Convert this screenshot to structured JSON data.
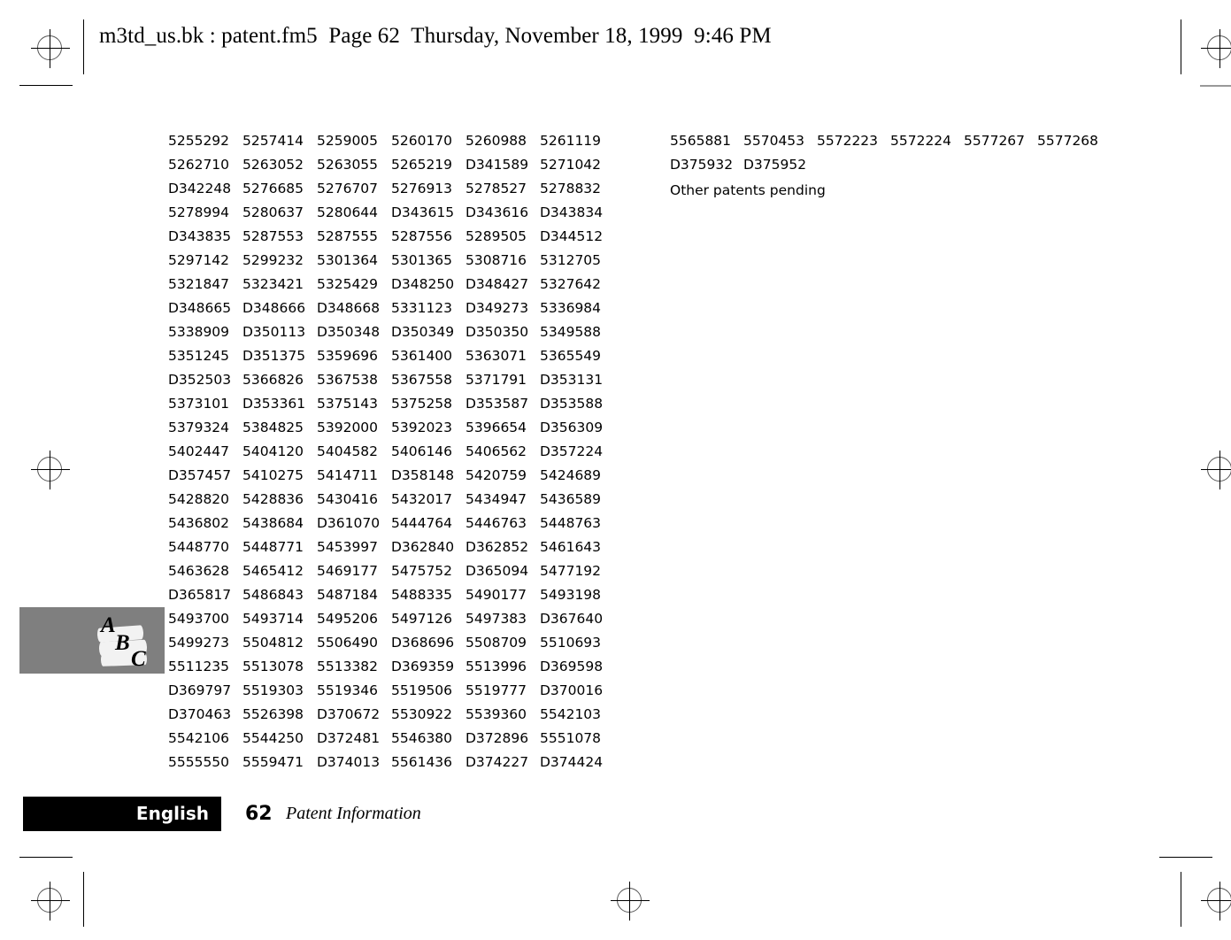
{
  "header": {
    "text": "m3td_us.bk : patent.fm5  Page 62  Thursday, November 18, 1999  9:46 PM"
  },
  "patents": {
    "left_block": {
      "columns": 6,
      "rows": [
        [
          "5255292",
          "5257414",
          "5259005",
          "5260170",
          "5260988",
          "5261119"
        ],
        [
          "5262710",
          "5263052",
          "5263055",
          "5265219",
          "D341589",
          "5271042"
        ],
        [
          "D342248",
          "5276685",
          "5276707",
          "5276913",
          "5278527",
          "5278832"
        ],
        [
          "5278994",
          "5280637",
          "5280644",
          "D343615",
          "D343616",
          "D343834"
        ],
        [
          "D343835",
          "5287553",
          "5287555",
          "5287556",
          "5289505",
          "D344512"
        ],
        [
          "5297142",
          "5299232",
          "5301364",
          "5301365",
          "5308716",
          "5312705"
        ],
        [
          "5321847",
          "5323421",
          "5325429",
          "D348250",
          "D348427",
          "5327642"
        ],
        [
          "D348665",
          "D348666",
          "D348668",
          "5331123",
          "D349273",
          "5336984"
        ],
        [
          "5338909",
          "D350113",
          "D350348",
          "D350349",
          "D350350",
          "5349588"
        ],
        [
          "5351245",
          "D351375",
          "5359696",
          "5361400",
          "5363071",
          "5365549"
        ],
        [
          "D352503",
          "5366826",
          "5367538",
          "5367558",
          "5371791",
          "D353131"
        ],
        [
          "5373101",
          "D353361",
          "5375143",
          "5375258",
          "D353587",
          "D353588"
        ],
        [
          "5379324",
          "5384825",
          "5392000",
          "5392023",
          "5396654",
          "D356309"
        ],
        [
          "5402447",
          "5404120",
          "5404582",
          "5406146",
          "5406562",
          "D357224"
        ],
        [
          "D357457",
          "5410275",
          "5414711",
          "D358148",
          "5420759",
          "5424689"
        ],
        [
          "5428820",
          "5428836",
          "5430416",
          "5432017",
          "5434947",
          "5436589"
        ],
        [
          "5436802",
          "5438684",
          "D361070",
          "5444764",
          "5446763",
          "5448763"
        ],
        [
          "5448770",
          "5448771",
          "5453997",
          "D362840",
          "D362852",
          "5461643"
        ],
        [
          "5463628",
          "5465412",
          "5469177",
          "5475752",
          "D365094",
          "5477192"
        ],
        [
          "D365817",
          "5486843",
          "5487184",
          "5488335",
          "5490177",
          "5493198"
        ],
        [
          "5493700",
          "5493714",
          "5495206",
          "5497126",
          "5497383",
          "D367640"
        ],
        [
          "5499273",
          "5504812",
          "5506490",
          "D368696",
          "5508709",
          "5510693"
        ],
        [
          "5511235",
          "5513078",
          "5513382",
          "D369359",
          "5513996",
          "D369598"
        ],
        [
          "D369797",
          "5519303",
          "5519346",
          "5519506",
          "5519777",
          "D370016"
        ],
        [
          "D370463",
          "5526398",
          "D370672",
          "5530922",
          "5539360",
          "5542103"
        ],
        [
          "5542106",
          "5544250",
          "D372481",
          "5546380",
          "D372896",
          "5551078"
        ],
        [
          "5555550",
          "5559471",
          "D374013",
          "5561436",
          "D374227",
          "D374424"
        ]
      ]
    },
    "right_block": {
      "columns": 6,
      "rows": [
        [
          "5565881",
          "5570453",
          "5572223",
          "5572224",
          "5577267",
          "5577268"
        ],
        [
          "D375932",
          "D375952",
          "",
          "",
          "",
          ""
        ]
      ]
    },
    "pending_note": "Other patents pending"
  },
  "side_tab": {
    "logo_letters": [
      "A",
      "B",
      "C"
    ],
    "background_color": "#7f7f7f"
  },
  "footer": {
    "language": "English",
    "page_number": "62",
    "section_title": "Patent Information",
    "bar_color": "#000000"
  }
}
